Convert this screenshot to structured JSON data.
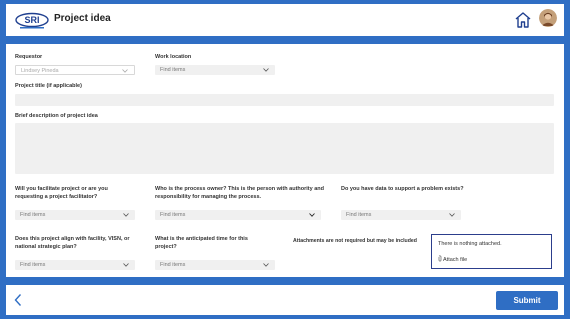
{
  "header": {
    "logo_text": "SRI",
    "title": "Project idea"
  },
  "form": {
    "requestor": {
      "label": "Requestor",
      "value": "Lindsey Pineda"
    },
    "work_location": {
      "label": "Work location",
      "placeholder": "Find items"
    },
    "project_title": {
      "label": "Project title (if applicable)"
    },
    "description": {
      "label": "Brief description of project idea"
    },
    "facilitate": {
      "label": "Will you facilitate project or are you requesting a project facilitator?",
      "placeholder": "Find items"
    },
    "process_owner": {
      "label": "Who is the process owner? This is the person with authority and responsibility for managing the process.",
      "placeholder": "Find items"
    },
    "data_support": {
      "label": "Do you have data to support a problem exists?",
      "placeholder": "Find items"
    },
    "align": {
      "label": "Does this project align with facility, VISN, or national strategic plan?",
      "placeholder": "Find items"
    },
    "timeline": {
      "label": "What is the anticipated time for this project?",
      "placeholder": "Find items"
    },
    "attachments": {
      "label": "Attachments are not required but may be included",
      "empty_text": "There is nothing attached.",
      "attach_label": "Attach file"
    }
  },
  "footer": {
    "submit_label": "Submit"
  },
  "colors": {
    "brand": "#2f6ec4",
    "attachment_border": "#2c3e8c"
  },
  "icons": [
    "sri-logo",
    "home-icon",
    "avatar",
    "chevron-down-icon",
    "paperclip-icon",
    "back-arrow-icon"
  ]
}
